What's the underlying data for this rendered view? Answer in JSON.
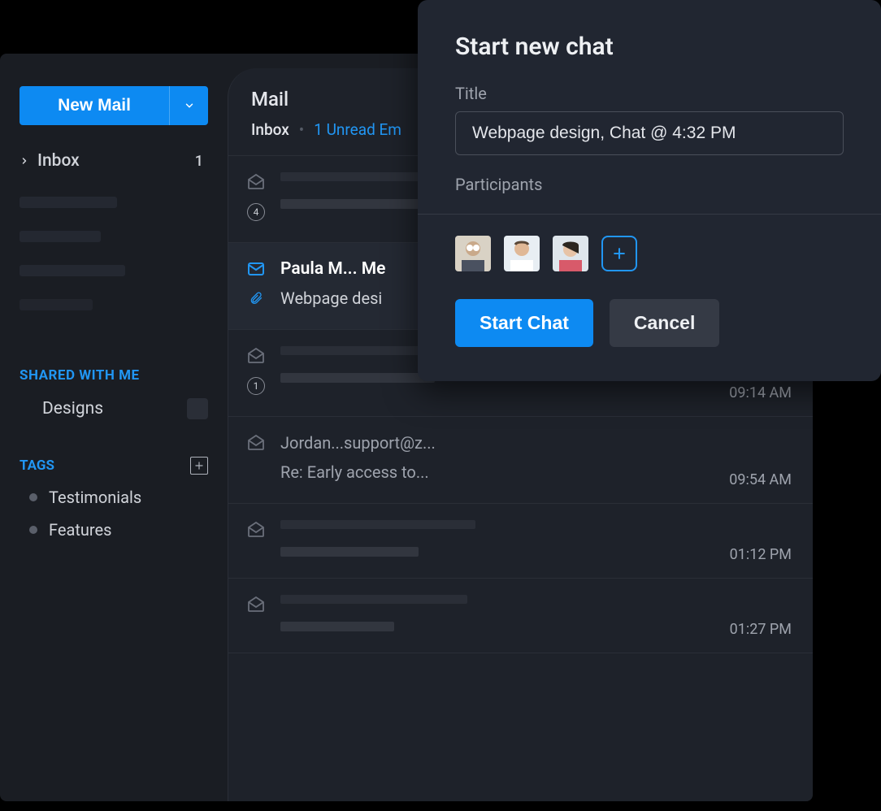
{
  "sidebar": {
    "new_mail_label": "New Mail",
    "inbox_label": "Inbox",
    "inbox_count": "1",
    "shared_label": "SHARED WITH ME",
    "designs_label": "Designs",
    "tags_label": "TAGS",
    "tags": [
      "Testimonials",
      "Features"
    ]
  },
  "list": {
    "title": "Mail",
    "inbox_label": "Inbox",
    "unread_label": "1 Unread Em",
    "rows": [
      {
        "count": "4"
      },
      {
        "from": "Paula M... Me",
        "subject": "Webpage desi"
      },
      {
        "count": "1",
        "time": "09:14 AM"
      },
      {
        "from": "Jordan...support@z...",
        "subject": "Re: Early access to...",
        "time": "09:54 AM"
      },
      {
        "time": "01:12 PM"
      },
      {
        "time": "01:27 PM"
      }
    ]
  },
  "dialog": {
    "title": "Start new chat",
    "title_field_label": "Title",
    "title_value": "Webpage design, Chat @ 4:32 PM",
    "participants_label": "Participants",
    "start_label": "Start Chat",
    "cancel_label": "Cancel"
  }
}
